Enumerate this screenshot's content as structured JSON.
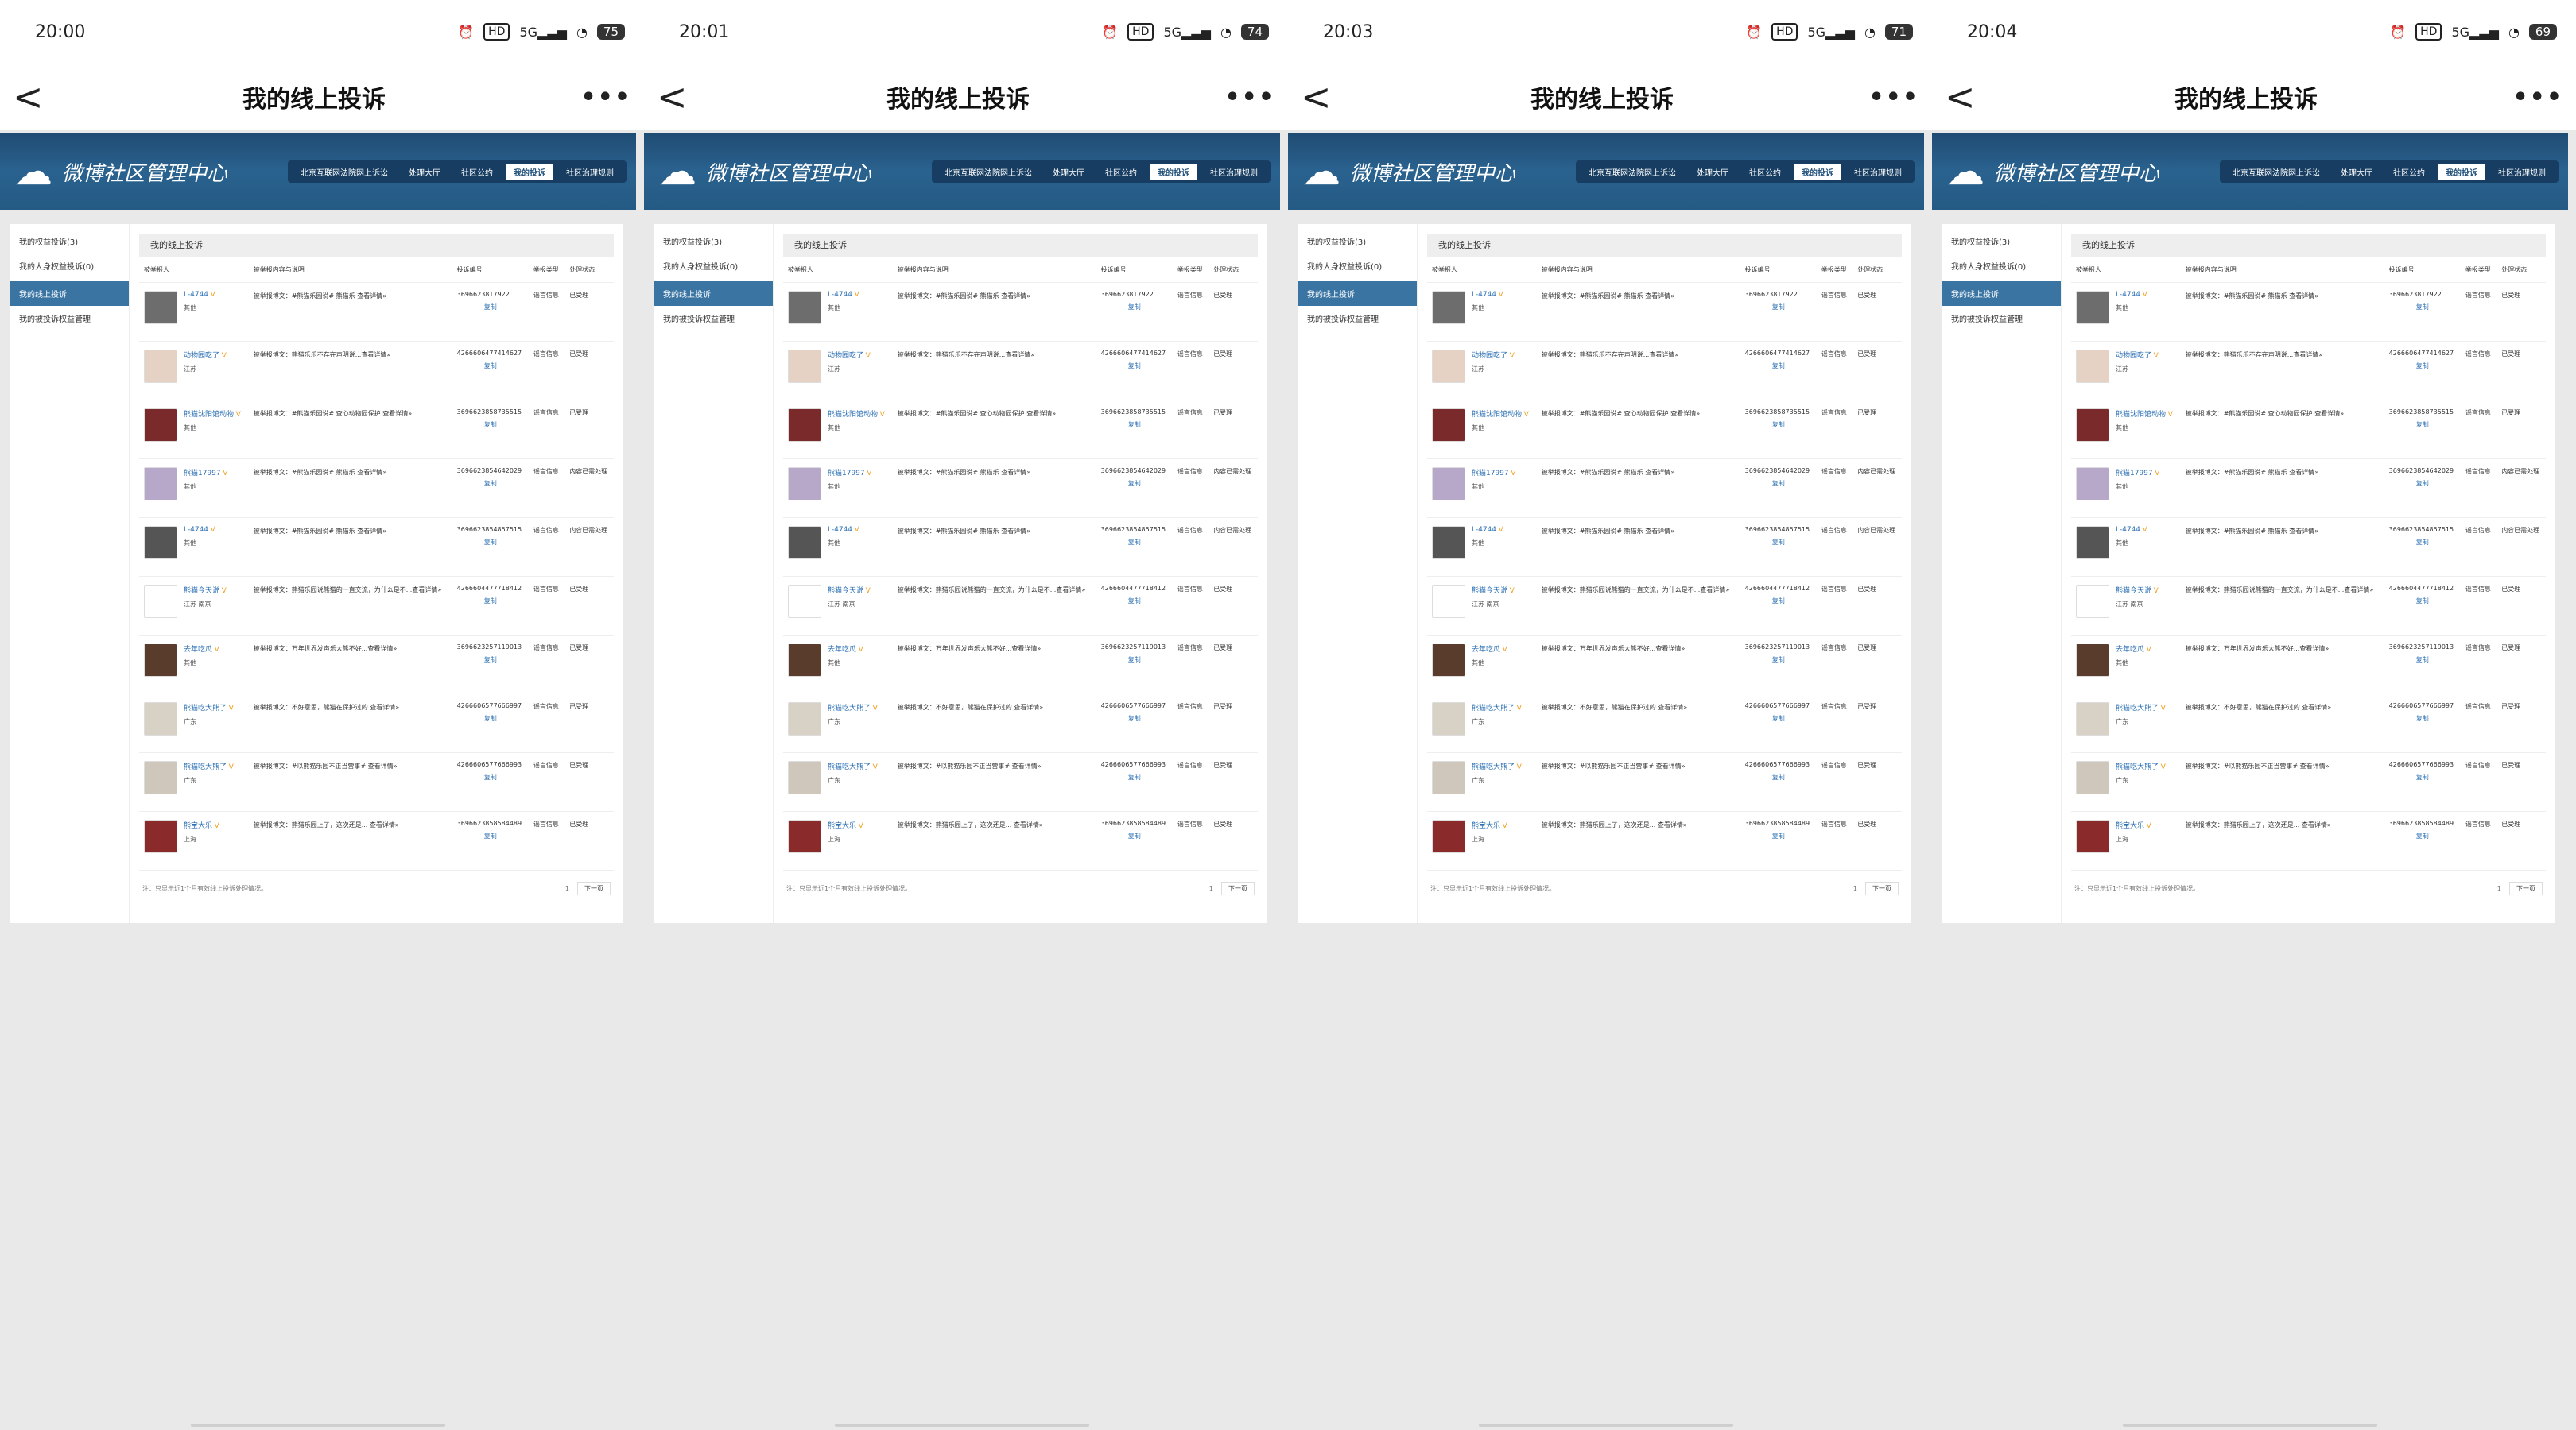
{
  "screens": [
    {
      "time": "20:00",
      "battery": "75"
    },
    {
      "time": "20:01",
      "battery": "74"
    },
    {
      "time": "20:03",
      "battery": "71"
    },
    {
      "time": "20:04",
      "battery": "69"
    }
  ],
  "header": {
    "title": "我的线上投诉",
    "more": "•••",
    "back": "<"
  },
  "site": {
    "logo_text": "微博社区管理中心",
    "menu": [
      "北京互联网法院网上诉讼",
      "处理大厅",
      "社区公约",
      "我的投诉",
      "社区治理规则"
    ]
  },
  "sidebar": [
    "我的权益投诉(3)",
    "我的人身权益投诉(0)",
    "我的线上投诉",
    "我的被投诉权益管理"
  ],
  "table": {
    "section_title": "我的线上投诉",
    "columns": [
      "被举报人",
      "被举报内容与说明",
      "投诉编号",
      "举报类型",
      "处理状态"
    ],
    "copy_label": "复制",
    "rows": [
      {
        "name": "L-4744",
        "loc": "其他",
        "reason": "被举报博文：#熊猫乐园说# 熊猫乐 查看详情»",
        "id": "3696623817922",
        "type": "谣言信息",
        "status": "已受理"
      },
      {
        "name": "动物园吃了",
        "loc": "江苏",
        "reason": "被举报博文：熊猫乐乐不存在声明说...查看详情»",
        "id": "4266606477414627",
        "type": "谣言信息",
        "status": "已受理"
      },
      {
        "name": "熊猫沈阳馆动物",
        "loc": "其他",
        "reason": "被举报博文：#熊猫乐园说# 查心动物园保护 查看详情»",
        "id": "3696623858735515",
        "type": "谣言信息",
        "status": "已受理"
      },
      {
        "name": "熊猫17997",
        "loc": "其他",
        "reason": "被举报博文：#熊猫乐园说# 熊猫乐 查看详情»",
        "id": "3696623854642029",
        "type": "谣言信息",
        "status": "内容已需处理"
      },
      {
        "name": "L-4744",
        "loc": "其他",
        "reason": "被举报博文：#熊猫乐园说# 熊猫乐 查看详情»",
        "id": "3696623854857515",
        "type": "谣言信息",
        "status": "内容已需处理"
      },
      {
        "name": "熊猫今天说",
        "loc": "江苏 南京",
        "reason": "被举报博文：熊猫乐园说熊猫的一直交流，为什么是不...查看详情»",
        "id": "4266604477718412",
        "type": "谣言信息",
        "status": "已受理"
      },
      {
        "name": "去年吃瓜",
        "loc": "其他",
        "reason": "被举报博文：万年世界发声乐大熊不好...查看详情»",
        "id": "3696623257119013",
        "type": "谣言信息",
        "status": "已受理"
      },
      {
        "name": "熊猫吃大熊了",
        "loc": "广东",
        "reason": "被举报博文：不好意思，熊猫在保护过的 查看详情»",
        "id": "4266606577666997",
        "type": "谣言信息",
        "status": "已受理"
      },
      {
        "name": "熊猫吃大熊了",
        "loc": "广东",
        "reason": "被举报博文：#以熊猫乐园不正当营事# 查看详情»",
        "id": "4266606577666993",
        "type": "谣言信息",
        "status": "已受理"
      },
      {
        "name": "熊宝大乐",
        "loc": "上海",
        "reason": "被举报博文：熊猫乐园上了，这次还是... 查看详情»",
        "id": "3696623858584489",
        "type": "谣言信息",
        "status": "已受理"
      }
    ],
    "footer_note": "注：只显示近1个月有效线上投诉处理情况。",
    "page": "1",
    "next": "下一页"
  },
  "colors": {
    "banner": "#2a628f",
    "accent": "#3a74a3",
    "link": "#2a6fb3"
  }
}
